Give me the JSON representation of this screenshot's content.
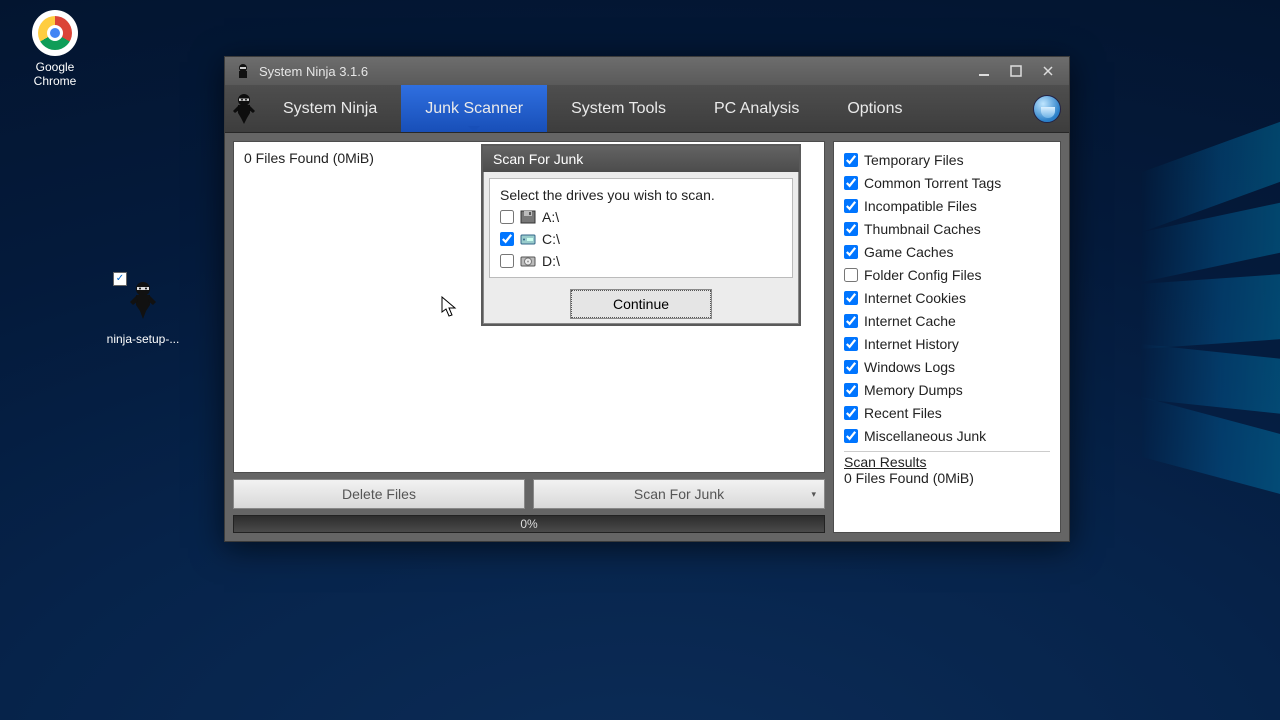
{
  "desktop": {
    "chrome_label": "Google\nChrome",
    "ninja_file_label": "ninja-setup-..."
  },
  "window": {
    "title": "System Ninja 3.1.6"
  },
  "tabs": {
    "system_ninja": "System Ninja",
    "junk_scanner": "Junk Scanner",
    "system_tools": "System Tools",
    "pc_analysis": "PC Analysis",
    "options": "Options"
  },
  "results": {
    "summary": "0 Files Found (0MiB)"
  },
  "buttons": {
    "delete": "Delete Files",
    "scan": "Scan For Junk"
  },
  "progress": {
    "text": "0%"
  },
  "side_options": [
    {
      "label": "Temporary Files",
      "checked": true
    },
    {
      "label": "Common Torrent Tags",
      "checked": true
    },
    {
      "label": "Incompatible Files",
      "checked": true
    },
    {
      "label": "Thumbnail Caches",
      "checked": true
    },
    {
      "label": "Game Caches",
      "checked": true
    },
    {
      "label": "Folder Config Files",
      "checked": false
    },
    {
      "label": "Internet Cookies",
      "checked": true
    },
    {
      "label": "Internet Cache",
      "checked": true
    },
    {
      "label": "Internet History",
      "checked": true
    },
    {
      "label": "Windows Logs",
      "checked": true
    },
    {
      "label": "Memory Dumps",
      "checked": true
    },
    {
      "label": "Recent Files",
      "checked": true
    },
    {
      "label": "Miscellaneous Junk",
      "checked": true
    }
  ],
  "scan_results": {
    "title": "Scan Results",
    "text": "0 Files Found (0MiB)"
  },
  "modal": {
    "title": "Scan For Junk",
    "instruction": "Select the drives you wish to scan.",
    "drives": [
      {
        "label": "A:\\",
        "checked": false,
        "kind": "floppy"
      },
      {
        "label": "C:\\",
        "checked": true,
        "kind": "hdd"
      },
      {
        "label": "D:\\",
        "checked": false,
        "kind": "optical"
      }
    ],
    "continue": "Continue"
  }
}
